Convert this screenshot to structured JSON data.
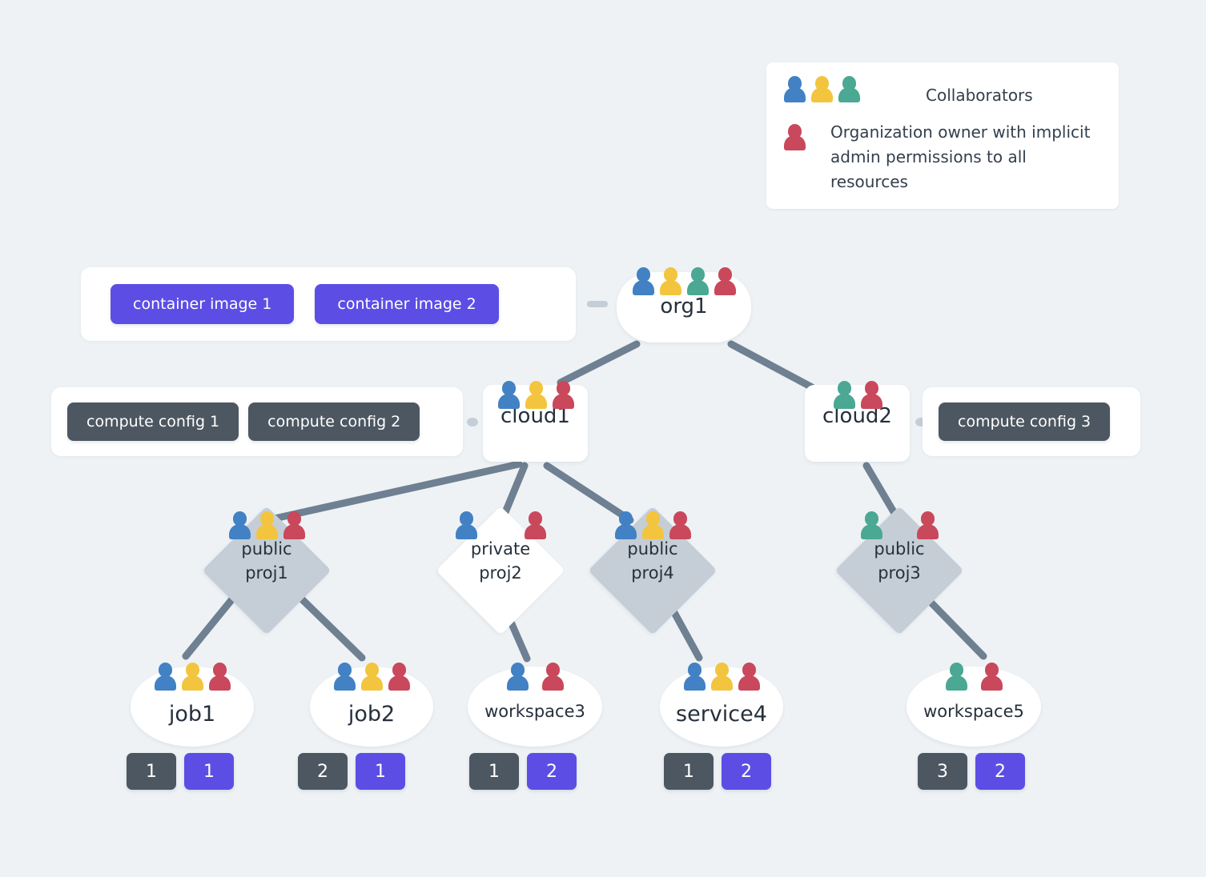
{
  "colors": {
    "background": "#eef2f5",
    "person_blue": "#4281c4",
    "person_yellow": "#f3c53f",
    "person_teal": "#4aa893",
    "person_red": "#c9485b",
    "edge": "#6e8091",
    "diamond_public": "#c5ced6",
    "diamond_private": "#ffffff",
    "badge_dark": "#4d5761",
    "badge_purple": "#5c4ee5",
    "node_text": "#26303c"
  },
  "legend": {
    "collaborators_label": "Collaborators",
    "collaborators_icons": [
      "person-blue",
      "person-yellow",
      "person-teal"
    ],
    "owner_label": "Organization owner with implicit admin permissions to all resources",
    "owner_icon": "person-red"
  },
  "org": {
    "label": "org1",
    "icons": [
      "person-blue",
      "person-yellow",
      "person-teal",
      "person-red"
    ]
  },
  "images_panel": {
    "chips": [
      {
        "label": "container image 1"
      },
      {
        "label": "container image 2"
      }
    ]
  },
  "configs_panel_left": {
    "chips": [
      {
        "label": "compute config 1"
      },
      {
        "label": "compute config 2"
      }
    ]
  },
  "configs_panel_right": {
    "chips": [
      {
        "label": "compute config 3"
      }
    ]
  },
  "clouds": [
    {
      "label": "cloud1",
      "icons": [
        "person-blue",
        "person-yellow",
        "person-red"
      ]
    },
    {
      "label": "cloud2",
      "icons": [
        "person-teal",
        "person-red"
      ]
    }
  ],
  "projects": [
    {
      "visibility": "public",
      "name": "proj1",
      "icons": [
        "person-blue",
        "person-yellow",
        "person-red"
      ]
    },
    {
      "visibility": "private",
      "name": "proj2",
      "icons": [
        "person-blue",
        "person-red"
      ]
    },
    {
      "visibility": "public",
      "name": "proj4",
      "icons": [
        "person-blue",
        "person-yellow",
        "person-red"
      ]
    },
    {
      "visibility": "public",
      "name": "proj3",
      "icons": [
        "person-teal",
        "person-red"
      ]
    }
  ],
  "leaves": [
    {
      "label": "job1",
      "icons": [
        "person-blue",
        "person-yellow",
        "person-red"
      ],
      "badges": [
        {
          "value": "1",
          "kind": "dark"
        },
        {
          "value": "1",
          "kind": "purple"
        }
      ]
    },
    {
      "label": "job2",
      "icons": [
        "person-blue",
        "person-yellow",
        "person-red"
      ],
      "badges": [
        {
          "value": "2",
          "kind": "dark"
        },
        {
          "value": "1",
          "kind": "purple"
        }
      ]
    },
    {
      "label": "workspace3",
      "icons": [
        "person-blue",
        "person-red"
      ],
      "badges": [
        {
          "value": "1",
          "kind": "dark"
        },
        {
          "value": "2",
          "kind": "purple"
        }
      ]
    },
    {
      "label": "service4",
      "icons": [
        "person-blue",
        "person-yellow",
        "person-red"
      ],
      "badges": [
        {
          "value": "1",
          "kind": "dark"
        },
        {
          "value": "2",
          "kind": "purple"
        }
      ]
    },
    {
      "label": "workspace5",
      "icons": [
        "person-teal",
        "person-red"
      ],
      "badges": [
        {
          "value": "3",
          "kind": "dark"
        },
        {
          "value": "2",
          "kind": "purple"
        }
      ]
    }
  ],
  "edges": [
    {
      "from": "org1",
      "to": "cloud1"
    },
    {
      "from": "org1",
      "to": "cloud2"
    },
    {
      "from": "cloud1",
      "to": "proj1"
    },
    {
      "from": "cloud1",
      "to": "proj2"
    },
    {
      "from": "cloud1",
      "to": "proj4"
    },
    {
      "from": "cloud2",
      "to": "proj3"
    },
    {
      "from": "proj1",
      "to": "job1"
    },
    {
      "from": "proj1",
      "to": "job2"
    },
    {
      "from": "proj2",
      "to": "workspace3"
    },
    {
      "from": "proj4",
      "to": "service4"
    },
    {
      "from": "proj3",
      "to": "workspace5"
    }
  ]
}
